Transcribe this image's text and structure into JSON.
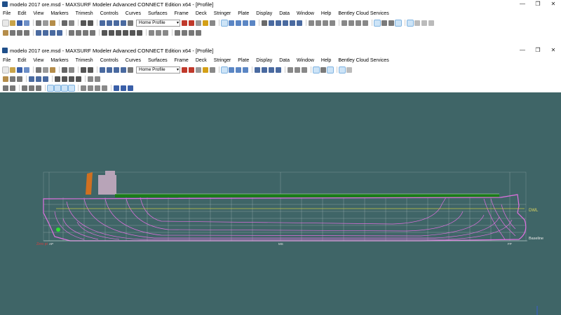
{
  "window": {
    "title": "modelo 2017 ore.msd - MAXSURF Modeler Advanced CONNECT Edition x64 - [Profile]",
    "minimize": "—",
    "restore": "❐",
    "close": "✕"
  },
  "menu": [
    "File",
    "Edit",
    "View",
    "Markers",
    "Trimesh",
    "Controls",
    "Curves",
    "Surfaces",
    "Frame",
    "Deck",
    "Stringer",
    "Plate",
    "Display",
    "Data",
    "Window",
    "Help",
    "Bentley Cloud Services"
  ],
  "toolbar": {
    "view_select": "Home Profile"
  },
  "viewport": {
    "labels": {
      "dwl": "DWL",
      "baseline": "Baseline",
      "zero_point": "Zero pt",
      "ap": "AP",
      "ms": "MS",
      "fp": "FP"
    },
    "colors": {
      "background": "#3f6567",
      "hull_lines": "#e070e0",
      "grid": "#b8c8c8",
      "deck": "#1a7a1a",
      "waterline": "#d8d040"
    }
  }
}
